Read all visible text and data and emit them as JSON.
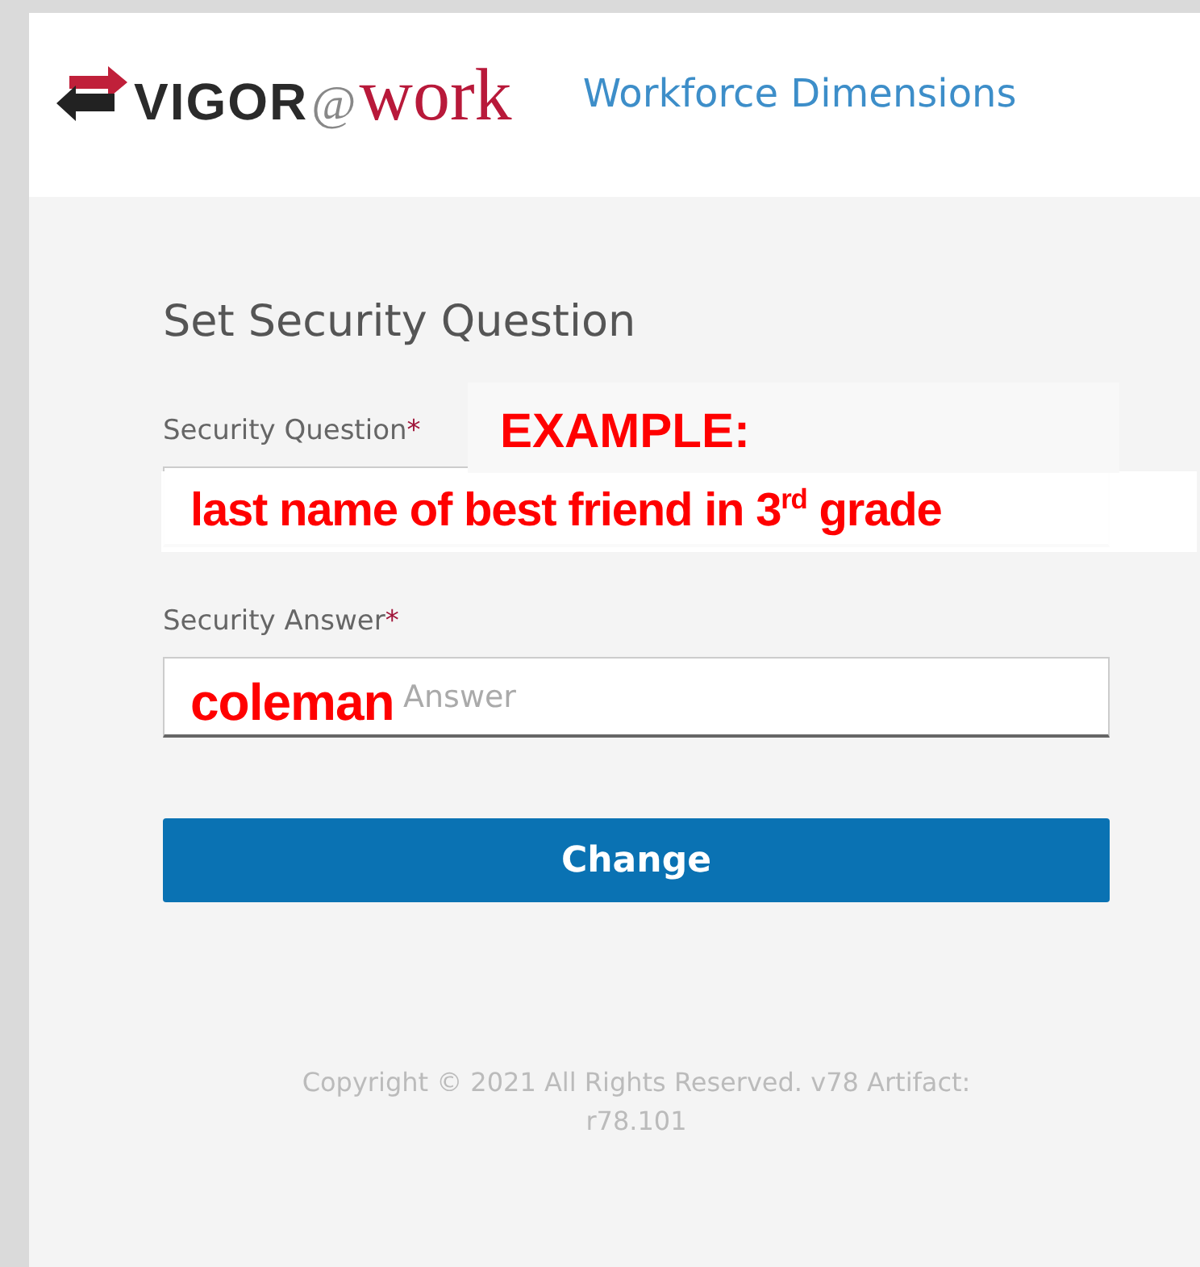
{
  "header": {
    "logo": {
      "brand": "VIGOR",
      "at": "@",
      "suffix": "work"
    },
    "product": "Workforce Dimensions"
  },
  "form": {
    "title": "Set Security Question",
    "fields": [
      {
        "label": "Security Question",
        "required": true,
        "required_mark": "*"
      },
      {
        "label": "Security Answer",
        "required": true,
        "required_mark": "*",
        "placeholder": "Answer"
      }
    ],
    "button": "Change"
  },
  "footer": "Copyright © 2021 All Rights Reserved. v78 Artifact: r78.101",
  "annotations": [
    {
      "kind": "heading",
      "text": "EXAMPLE:"
    },
    {
      "kind": "question",
      "text": "last name of best friend in 3$^{rd}$ grade"
    },
    {
      "kind": "answer",
      "text": "coleman"
    }
  ]
}
